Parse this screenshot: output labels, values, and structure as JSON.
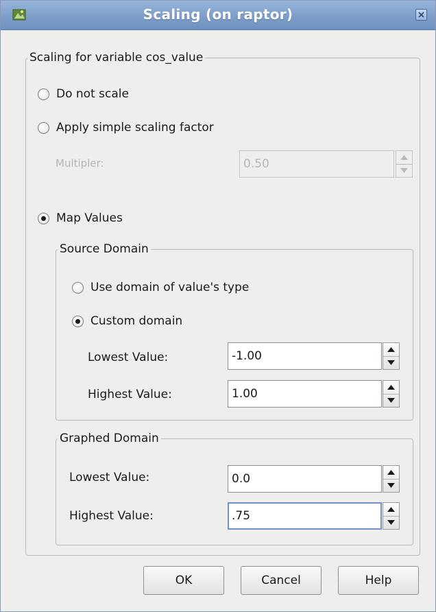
{
  "window": {
    "title": "Scaling (on raptor)"
  },
  "scaling": {
    "group_title": "Scaling for variable cos_value",
    "options": {
      "do_not_scale": "Do not scale",
      "apply_factor": "Apply simple scaling factor",
      "map_values": "Map Values"
    },
    "selected": "map_values",
    "multiplier": {
      "label": "Multipler:",
      "value": "0.50"
    }
  },
  "source_domain": {
    "title": "Source Domain",
    "use_type_domain": "Use domain of value's type",
    "custom_domain": "Custom domain",
    "selected": "custom_domain",
    "lowest": {
      "label": "Lowest Value:",
      "value": "-1.00"
    },
    "highest": {
      "label": "Highest Value:",
      "value": "1.00"
    }
  },
  "graphed_domain": {
    "title": "Graphed Domain",
    "lowest": {
      "label": "Lowest Value:",
      "value": "0.0"
    },
    "highest": {
      "label": "Highest Value:",
      "value": ".75"
    }
  },
  "buttons": {
    "ok": "OK",
    "cancel": "Cancel",
    "help": "Help"
  },
  "colors": {
    "titlebar": "#7e9ec9",
    "dialog_bg": "#eeeeec",
    "focus_border": "#6f94c8"
  }
}
